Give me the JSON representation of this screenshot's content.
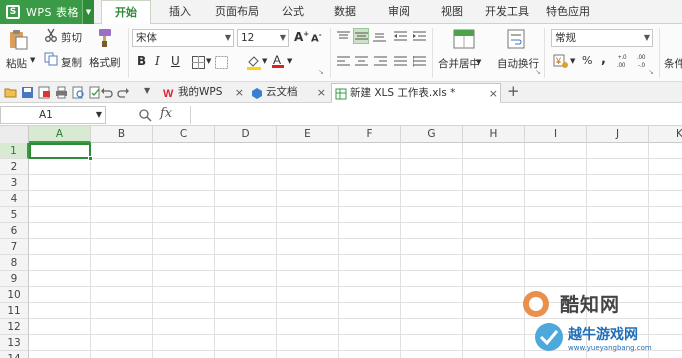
{
  "app": {
    "button_label": "WPS 表格",
    "logo_letter": "S"
  },
  "menu": {
    "tabs": [
      "开始",
      "插入",
      "页面布局",
      "公式",
      "数据",
      "审阅",
      "视图",
      "开发工具",
      "特色应用"
    ],
    "active_index": 0
  },
  "ribbon": {
    "paste_label": "粘贴",
    "cut_label": "剪切",
    "copy_label": "复制",
    "format_painter_label": "格式刷",
    "font_name": "宋体",
    "font_size": "12",
    "bold": "B",
    "italic": "I",
    "underline": "U",
    "merge_center_label": "合并居中",
    "wrap_text_label": "自动换行",
    "number_format": "常规",
    "percent": "%",
    "thousands": ",",
    "conditional_label": "条件"
  },
  "doc_tabs": [
    {
      "label": "我的WPS",
      "icon": "wps-logo-icon",
      "close": "×"
    },
    {
      "label": "云文档",
      "icon": "cloud-doc-icon",
      "close": "×"
    },
    {
      "label": "新建 XLS 工作表.xls *",
      "icon": "sheet-doc-icon",
      "close": "×"
    }
  ],
  "add_tab": "+",
  "formula_bar": {
    "name_box": "A1",
    "fx": "fx"
  },
  "columns": [
    "A",
    "B",
    "C",
    "D",
    "E",
    "F",
    "G",
    "H",
    "I",
    "J",
    "K"
  ],
  "rows": [
    "1",
    "2",
    "3",
    "4",
    "5",
    "6",
    "7",
    "8",
    "9",
    "10",
    "11",
    "12",
    "13",
    "14"
  ],
  "selected_cell": "A1",
  "watermark": {
    "line1": "酷知网",
    "line2": "越牛游戏网",
    "url": "www.yueyangbang.com"
  },
  "colors": {
    "accent": "#3b9a45",
    "selection": "#d9ead3"
  }
}
